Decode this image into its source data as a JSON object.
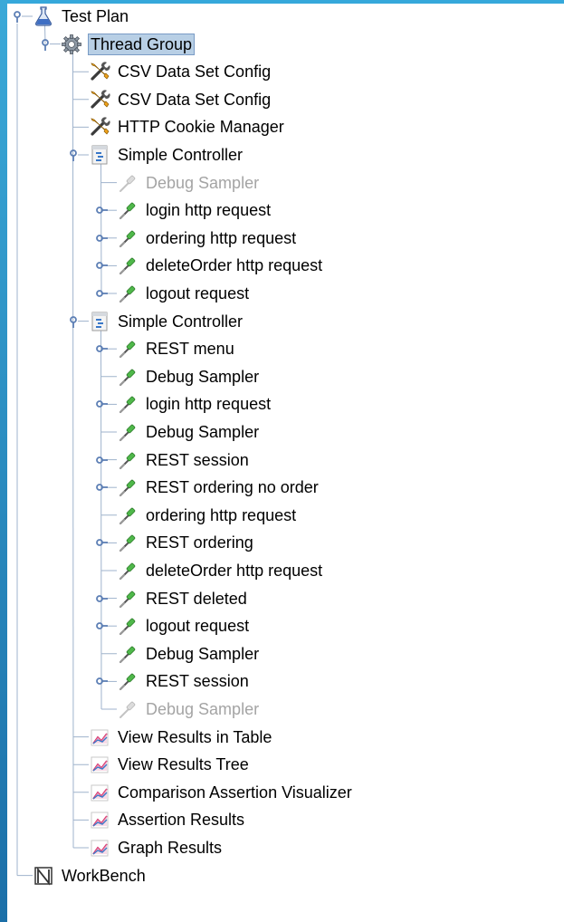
{
  "tree": {
    "nodes": [
      {
        "id": "test-plan",
        "label": "Test Plan",
        "icon": "flask-icon",
        "depth": 0,
        "expanded": true
      },
      {
        "id": "thread-group",
        "label": "Thread Group",
        "icon": "gear-icon",
        "depth": 1,
        "expanded": true,
        "selected": true
      },
      {
        "id": "csv-1",
        "label": "CSV Data Set Config",
        "icon": "wrench-screwdriver-icon",
        "depth": 2
      },
      {
        "id": "csv-2",
        "label": "CSV Data Set Config",
        "icon": "wrench-screwdriver-icon",
        "depth": 2
      },
      {
        "id": "cookie",
        "label": "HTTP Cookie Manager",
        "icon": "wrench-screwdriver-icon",
        "depth": 2
      },
      {
        "id": "ctrl-1",
        "label": "Simple Controller",
        "icon": "controller-icon",
        "depth": 2,
        "expanded": true
      },
      {
        "id": "n6",
        "label": "Debug Sampler",
        "icon": "pipette-icon",
        "depth": 3,
        "disabled": true
      },
      {
        "id": "n7",
        "label": "login http request",
        "icon": "pipette-icon",
        "depth": 3,
        "expandable": true
      },
      {
        "id": "n8",
        "label": "ordering http request",
        "icon": "pipette-icon",
        "depth": 3,
        "expandable": true
      },
      {
        "id": "n9",
        "label": "deleteOrder http request",
        "icon": "pipette-icon",
        "depth": 3,
        "expandable": true
      },
      {
        "id": "n10",
        "label": "logout request",
        "icon": "pipette-icon",
        "depth": 3,
        "expandable": true
      },
      {
        "id": "ctrl-2",
        "label": "Simple Controller",
        "icon": "controller-icon",
        "depth": 2,
        "expanded": true
      },
      {
        "id": "n12",
        "label": "REST menu",
        "icon": "pipette-icon",
        "depth": 3,
        "expandable": true
      },
      {
        "id": "n13",
        "label": "Debug Sampler",
        "icon": "pipette-icon",
        "depth": 3
      },
      {
        "id": "n14",
        "label": "login http request",
        "icon": "pipette-icon",
        "depth": 3,
        "expandable": true
      },
      {
        "id": "n15",
        "label": "Debug Sampler",
        "icon": "pipette-icon",
        "depth": 3
      },
      {
        "id": "n16",
        "label": "REST session",
        "icon": "pipette-icon",
        "depth": 3,
        "expandable": true
      },
      {
        "id": "n17",
        "label": "REST ordering no order",
        "icon": "pipette-icon",
        "depth": 3,
        "expandable": true
      },
      {
        "id": "n18",
        "label": "ordering http request",
        "icon": "pipette-icon",
        "depth": 3
      },
      {
        "id": "n19",
        "label": "REST ordering",
        "icon": "pipette-icon",
        "depth": 3,
        "expandable": true
      },
      {
        "id": "n20",
        "label": "deleteOrder http request",
        "icon": "pipette-icon",
        "depth": 3
      },
      {
        "id": "n21",
        "label": "REST deleted",
        "icon": "pipette-icon",
        "depth": 3,
        "expandable": true
      },
      {
        "id": "n22",
        "label": "logout request",
        "icon": "pipette-icon",
        "depth": 3,
        "expandable": true
      },
      {
        "id": "n23",
        "label": "Debug Sampler",
        "icon": "pipette-icon",
        "depth": 3
      },
      {
        "id": "n24",
        "label": "REST session",
        "icon": "pipette-icon",
        "depth": 3,
        "expandable": true
      },
      {
        "id": "n25",
        "label": "Debug Sampler",
        "icon": "pipette-icon",
        "depth": 3,
        "disabled": true
      },
      {
        "id": "n26",
        "label": "View Results in Table",
        "icon": "graph-icon",
        "depth": 2
      },
      {
        "id": "n27",
        "label": "View Results Tree",
        "icon": "graph-icon",
        "depth": 2
      },
      {
        "id": "n28",
        "label": "Comparison Assertion Visualizer",
        "icon": "graph-icon",
        "depth": 2
      },
      {
        "id": "n29",
        "label": "Assertion Results",
        "icon": "graph-icon",
        "depth": 2
      },
      {
        "id": "n30",
        "label": "Graph Results",
        "icon": "graph-icon",
        "depth": 2
      },
      {
        "id": "workbench",
        "label": "WorkBench",
        "icon": "workbench-icon",
        "depth": 0
      }
    ]
  },
  "colors": {
    "window_accent": "#35a8db",
    "selection_bg": "#b8cfe5",
    "selection_border": "#7a9cc6",
    "tree_line": "#9fb3cc",
    "handle": "#5d7fb5",
    "disabled_text": "#a4a4a4"
  }
}
